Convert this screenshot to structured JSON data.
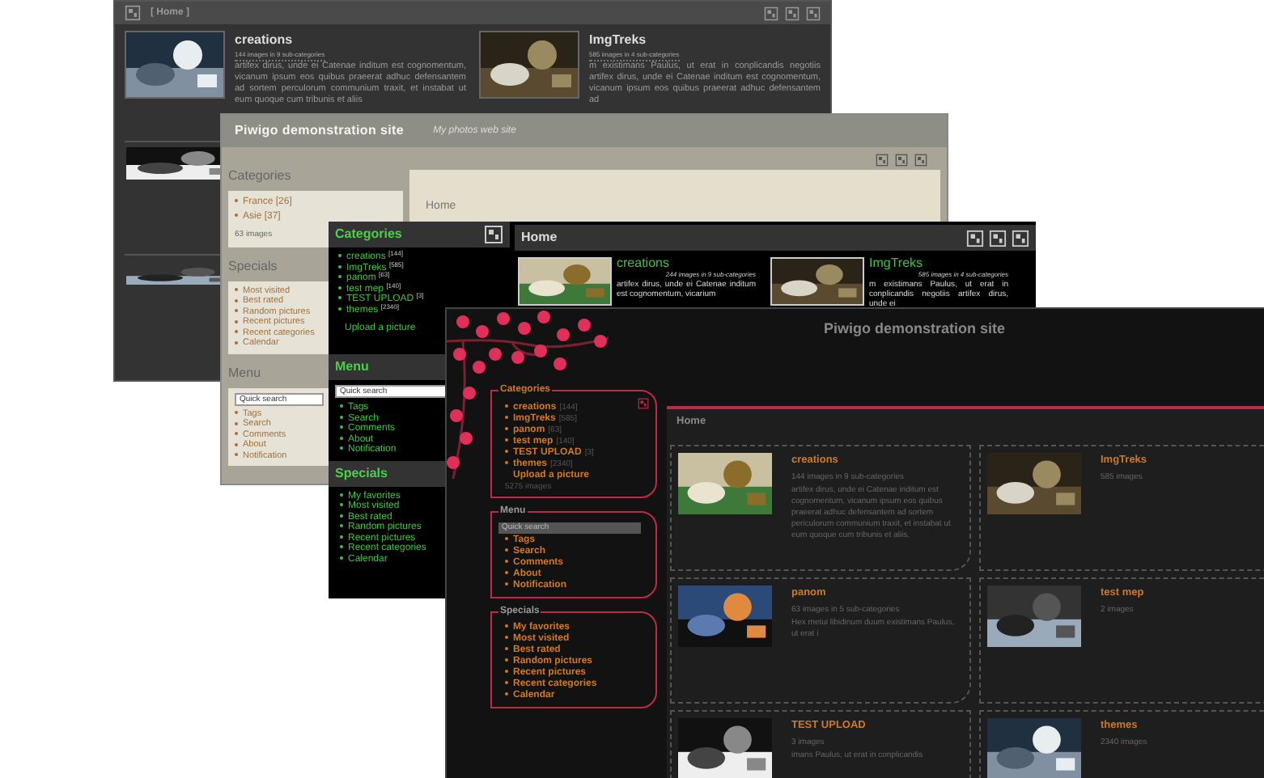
{
  "windows": [
    {
      "kind": "graphite",
      "breadcrumb": "[ Home ]",
      "albums": [
        {
          "title": "creations",
          "count": "144 images in 9 sub-categories",
          "description": "artifex dirus, unde ei Catenae inditum est cognomentum, vicanum ipsum eos quibus praeerat adhuc defensantem ad sortem perculorum communium traxit, et instabat ut eum quoque cum tribunis et aliis"
        },
        {
          "title": "ImgTreks",
          "count": "585 images in 4 sub-categories",
          "description": "m existimans Paulus, ut erat in conplicandis negotiis artifex dirus, unde ei Catenae inditum est cognomentum, vicanum ipsum eos quibus praeerat adhuc defensantem ad"
        }
      ]
    },
    {
      "kind": "clear",
      "title": "Piwigo demonstration site",
      "subtitle": "My photos web site",
      "breadcrumb": "Home",
      "categories": {
        "heading": "Categories",
        "items": [
          {
            "name": "France",
            "count": "[26]"
          },
          {
            "name": "Asie",
            "count": "[37]"
          }
        ],
        "total": "63 images"
      },
      "specials": {
        "heading": "Specials",
        "items": [
          "Most visited",
          "Best rated",
          "Random pictures",
          "Recent pictures",
          "Recent categories",
          "Calendar"
        ]
      },
      "menu": {
        "heading": "Menu",
        "search_placeholder": "Quick search",
        "items": [
          "Tags",
          "Search",
          "Comments",
          "About",
          "Notification"
        ]
      }
    },
    {
      "kind": "green",
      "breadcrumb": "Home",
      "categories": {
        "heading": "Categories",
        "items": [
          {
            "name": "creations",
            "count": "[144]"
          },
          {
            "name": "ImgTreks",
            "count": "[585]"
          },
          {
            "name": "panom",
            "count": "[63]"
          },
          {
            "name": "test mep",
            "count": "[140]"
          },
          {
            "name": "TEST UPLOAD",
            "count": "[3]"
          },
          {
            "name": "themes",
            "count": "[2340]"
          }
        ],
        "upload": "Upload a picture"
      },
      "menu": {
        "heading": "Menu",
        "search_placeholder": "Quick search",
        "items": [
          "Tags",
          "Search",
          "Comments",
          "About",
          "Notification"
        ]
      },
      "specials": {
        "heading": "Specials",
        "items": [
          "My favorites",
          "Most visited",
          "Best rated",
          "Random pictures",
          "Recent pictures",
          "Recent categories",
          "Calendar"
        ]
      },
      "albums": [
        {
          "title": "creations",
          "count": "244 images in 9 sub-categories",
          "description": "artifex dirus, unde ei Catenae inditum est cognomentum, vicarium"
        },
        {
          "title": "ImgTreks",
          "count": "585 images in 4 sub-categories",
          "description": "m existimans Paulus, ut erat in conplicandis negotiis artifex dirus, unde ei"
        }
      ]
    },
    {
      "kind": "sakura",
      "title": "Piwigo demonstration site",
      "breadcrumb": "Home",
      "categories": {
        "heading": "Categories",
        "items": [
          {
            "name": "creations",
            "count": "[144]"
          },
          {
            "name": "ImgTreks",
            "count": "[585]"
          },
          {
            "name": "panom",
            "count": "[63]"
          },
          {
            "name": "test mep",
            "count": "[140]"
          },
          {
            "name": "TEST UPLOAD",
            "count": "[3]"
          },
          {
            "name": "themes",
            "count": "[2340]"
          }
        ],
        "upload": "Upload a picture",
        "total": "5275 images"
      },
      "menu": {
        "heading": "Menu",
        "search_placeholder": "Quick search",
        "items": [
          "Tags",
          "Search",
          "Comments",
          "About",
          "Notification"
        ]
      },
      "specials": {
        "heading": "Specials",
        "items": [
          "My favorites",
          "Most visited",
          "Best rated",
          "Random pictures",
          "Recent pictures",
          "Recent categories",
          "Calendar"
        ]
      },
      "albums": [
        {
          "title": "creations",
          "count": "144 images in 9 sub-categories",
          "description": "artifex dirus, unde ei Catenae inditum est cognomentum, vicanum ipsum eos quibus praeerat adhuc defensantem ad sortem periculorum communium traxit, et instabat ut eum quoque cum tribunis et aliis."
        },
        {
          "title": "ImgTreks",
          "count": "585 images"
        },
        {
          "title": "panom",
          "count": "63 images in 5 sub-categories",
          "description": "Hex metui libidinum duum existimans Paulus, ut erat i"
        },
        {
          "title": "test mep",
          "count": "2 images"
        },
        {
          "title": "TEST UPLOAD",
          "count": "3 images",
          "description": "imans Paulus, ut erat in conplicandis"
        },
        {
          "title": "themes",
          "count": "2340 images"
        }
      ]
    }
  ]
}
